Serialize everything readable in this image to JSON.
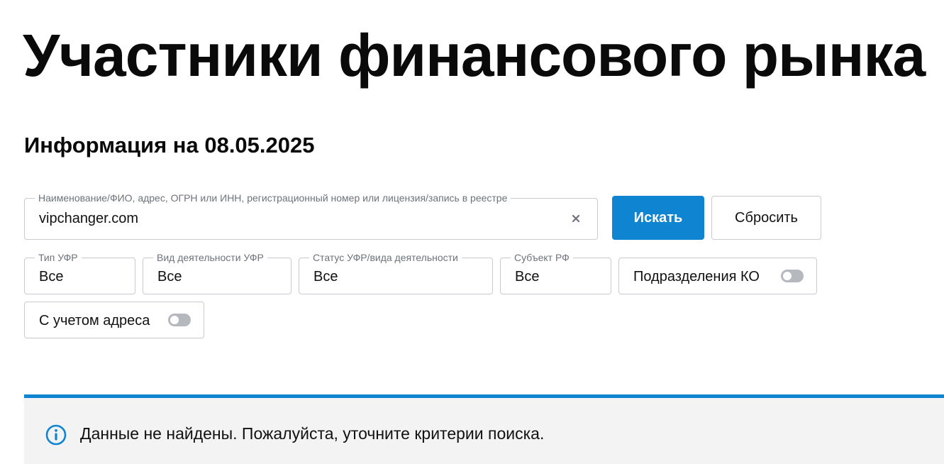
{
  "header": {
    "title": "Участники финансового рынка",
    "info_date": "Информация на 08.05.2025"
  },
  "search": {
    "legend": "Наименование/ФИО, адрес, ОГРН или ИНН, регистрационный номер или лицензия/запись в реестре",
    "value": "vipchanger.com",
    "clear_icon": "close-icon",
    "search_label": "Искать",
    "reset_label": "Сбросить"
  },
  "filters": {
    "type": {
      "legend": "Тип УФР",
      "value": "Все"
    },
    "activity": {
      "legend": "Вид деятельности УФР",
      "value": "Все"
    },
    "status": {
      "legend": "Статус УФР/вида деятельности",
      "value": "Все"
    },
    "subject": {
      "legend": "Субъект РФ",
      "value": "Все"
    },
    "ko_divisions": {
      "label": "Подразделения КО",
      "enabled": false
    },
    "with_address": {
      "label": "С учетом адреса",
      "enabled": false
    }
  },
  "notice": {
    "icon": "info-icon",
    "text": "Данные не найдены. Пожалуйста, уточните критерии поиска."
  },
  "colors": {
    "accent": "#0f84d1",
    "border": "#c7cbd0",
    "notice_bg": "#f3f3f3",
    "toggle_off": "#b5b9be"
  }
}
